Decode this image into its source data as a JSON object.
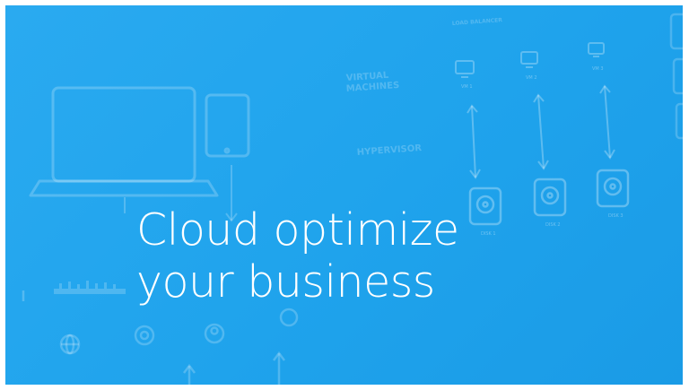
{
  "banner": {
    "headline_line1": "Cloud optimize",
    "headline_line2": "your business"
  },
  "diagram": {
    "label_virtual": "VIRTUAL",
    "label_machines": "MACHINES",
    "label_hypervisor": "HYPERVISOR",
    "label_load_balancer": "LOAD BALANCER",
    "vm_labels": [
      "VM 1",
      "VM 2",
      "VM 3"
    ],
    "disk_labels": [
      "DISK 1",
      "DISK 2",
      "DISK 3"
    ]
  },
  "colors": {
    "background": "#1fa3ec",
    "foreground": "#ffffff"
  }
}
